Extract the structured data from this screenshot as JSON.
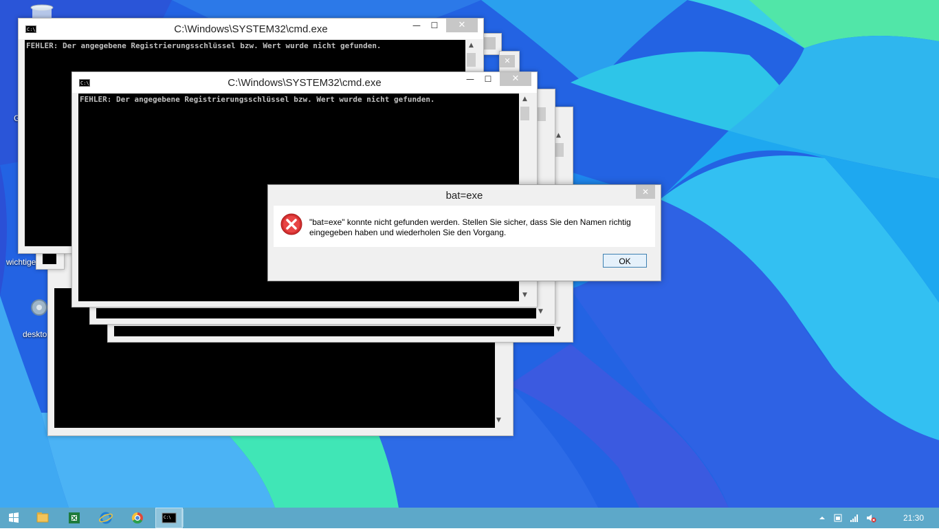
{
  "desktop_icons": [
    {
      "label": "G",
      "name": "desktop-icon-partial-g"
    },
    {
      "label": "wichtige",
      "name": "desktop-icon-wichtige"
    },
    {
      "label": "deskto",
      "name": "desktop-icon-deskto"
    }
  ],
  "console_windows": [
    {
      "title": "C:\\Windows\\SYSTEM32\\cmd.exe",
      "text": "FEHLER: Der angegebene Registrierungsschlüssel bzw. Wert wurde nicht gefunden."
    },
    {
      "title": "C:\\Windows\\SYSTEM32\\cmd.exe",
      "text": "FEHLER: Der angegebene Registrierungsschlüssel bzw. Wert wurde nicht gefunden."
    }
  ],
  "console_icon_text": "C:\\",
  "window_controls": {
    "minimize": "—",
    "maximize": "☐",
    "close": "✕"
  },
  "scroll_arrows": {
    "up": "▲",
    "down": "▼"
  },
  "dialog": {
    "title": "bat=exe",
    "message_line1": "\"bat=exe\" konnte nicht gefunden werden. Stellen Sie sicher, dass Sie den Namen richtig",
    "message_line2": "eingegeben haben und wiederholen Sie den Vorgang.",
    "ok_label": "OK",
    "close": "✕"
  },
  "taskbar": {
    "clock": "21:30",
    "items": [
      "start-button",
      "file-explorer",
      "excel",
      "internet-explorer",
      "chrome",
      "cmd"
    ],
    "accent": "#5da8c9"
  }
}
